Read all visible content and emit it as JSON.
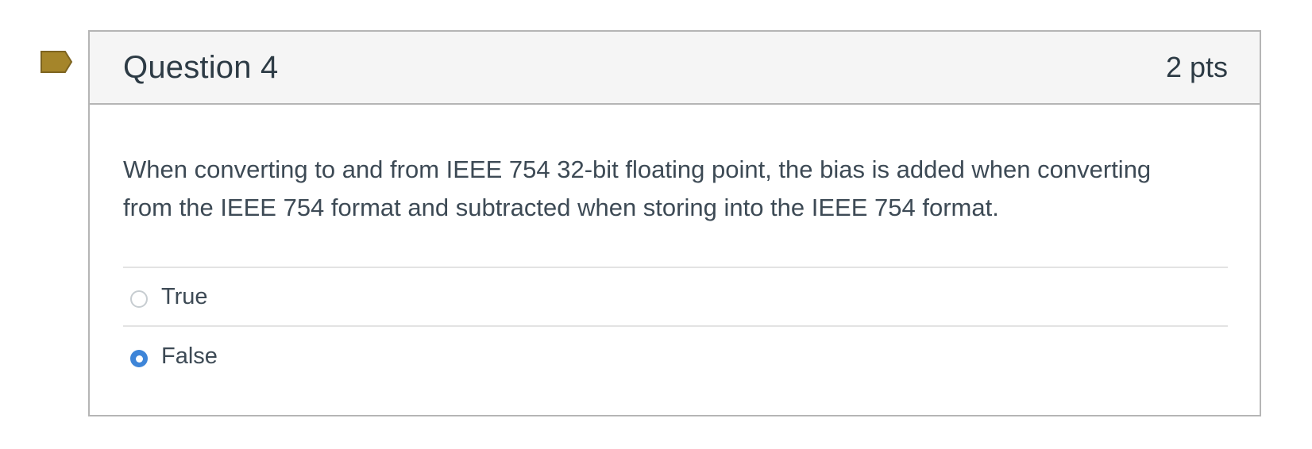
{
  "question": {
    "title": "Question 4",
    "points": "2 pts",
    "text": "When converting to and from IEEE 754 32-bit floating point, the bias is added when converting from the IEEE 754 format and subtracted when storing into the IEEE 754 format.",
    "flag_icon": "bookmark-flag-icon",
    "flag_color": "#a5852a",
    "answers": [
      {
        "label": "True",
        "selected": false
      },
      {
        "label": "False",
        "selected": true
      }
    ],
    "selected_color": "#3e85d8"
  }
}
